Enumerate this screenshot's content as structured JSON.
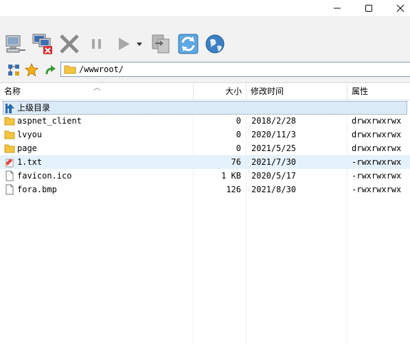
{
  "window": {
    "minimize_icon": "minimize-icon",
    "maximize_icon": "maximize-icon",
    "close_icon": "close-icon"
  },
  "toolbar": {
    "items": [
      "connect-icon",
      "disconnect-icon",
      "cancel-icon",
      "pause-icon",
      "play-icon",
      "dropdown-arrow-icon",
      "copy-file-icon",
      "refresh-icon",
      "globe-icon"
    ]
  },
  "address": {
    "path": "/wwwroot/"
  },
  "columns": {
    "name": "名称",
    "size": "大小",
    "date": "修改时间",
    "attr": "属性"
  },
  "parent_row": {
    "label": "上级目录"
  },
  "files": [
    {
      "name": "aspnet_client",
      "size": "0",
      "date": "2018/2/28",
      "attr": "drwxrwxrwx",
      "type": "folder"
    },
    {
      "name": "lvyou",
      "size": "0",
      "date": "2020/11/3",
      "attr": "drwxrwxrwx",
      "type": "folder"
    },
    {
      "name": "page",
      "size": "0",
      "date": "2021/5/25",
      "attr": "drwxrwxrwx",
      "type": "folder"
    },
    {
      "name": "1.txt",
      "size": "76",
      "date": "2021/7/30",
      "attr": "-rwxrwxrwx",
      "type": "text"
    },
    {
      "name": "favicon.ico",
      "size": "1 KB",
      "date": "2020/5/17",
      "attr": "-rwxrwxrwx",
      "type": "file"
    },
    {
      "name": "fora.bmp",
      "size": "126",
      "date": "2021/8/30",
      "attr": "-rwxrwxrwx",
      "type": "file"
    }
  ]
}
